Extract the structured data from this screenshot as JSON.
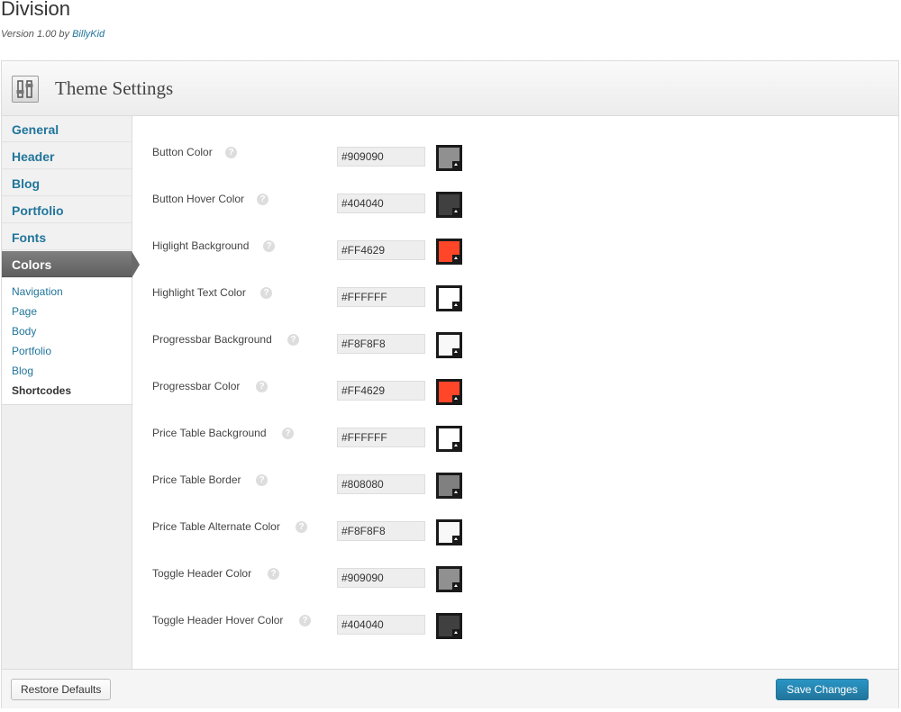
{
  "app": {
    "title": "Division",
    "version_prefix": "Version 1.00 by ",
    "author": "BillyKid"
  },
  "panel": {
    "title": "Theme Settings",
    "icon": "sliders-icon"
  },
  "nav": {
    "items": [
      {
        "label": "General"
      },
      {
        "label": "Header"
      },
      {
        "label": "Blog"
      },
      {
        "label": "Portfolio"
      },
      {
        "label": "Fonts"
      },
      {
        "label": "Colors",
        "active": true
      }
    ],
    "subitems": [
      {
        "label": "Navigation"
      },
      {
        "label": "Page"
      },
      {
        "label": "Body"
      },
      {
        "label": "Portfolio"
      },
      {
        "label": "Blog"
      },
      {
        "label": "Shortcodes",
        "current": true
      }
    ]
  },
  "help_glyph": "?",
  "settings": [
    {
      "label": "Button Color",
      "value": "#909090"
    },
    {
      "label": "Button Hover Color",
      "value": "#404040"
    },
    {
      "label": "Higlight Background",
      "value": "#FF4629"
    },
    {
      "label": "Highlight Text Color",
      "value": "#FFFFFF"
    },
    {
      "label": "Progressbar Background",
      "value": "#F8F8F8"
    },
    {
      "label": "Progressbar Color",
      "value": "#FF4629"
    },
    {
      "label": "Price Table Background",
      "value": "#FFFFFF"
    },
    {
      "label": "Price Table Border",
      "value": "#808080"
    },
    {
      "label": "Price Table Alternate Color",
      "value": "#F8F8F8"
    },
    {
      "label": "Toggle Header Color",
      "value": "#909090"
    },
    {
      "label": "Toggle Header Hover Color",
      "value": "#404040"
    }
  ],
  "footer": {
    "restore_label": "Restore Defaults",
    "save_label": "Save Changes"
  }
}
